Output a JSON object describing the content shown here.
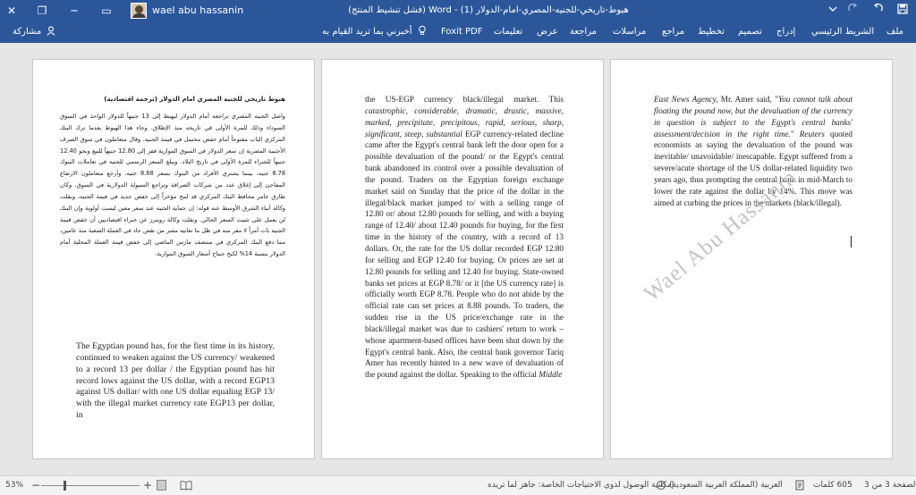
{
  "titlebar": {
    "doc_title": "هبوط-تاريخي-للجنيه-المصري-امام-الدولار (1) - Word (فشل تنشيط المنتج)",
    "user_name": "wael abu hassanin",
    "save_icon": "save-icon",
    "undo_icon": "undo-icon",
    "redo_icon": "redo-icon",
    "customize_icon": "dropdown-icon",
    "close_glyph": "✕",
    "maximize_glyph": "❐",
    "minimize_glyph": "─",
    "ribbon_display_glyph": "▭"
  },
  "ribbon": {
    "tabs": [
      "ملف",
      "الشريط الرئيسي",
      "إدراج",
      "تصميم",
      "تخطيط",
      "مراجع",
      "مراسلات",
      "مراجعة",
      "عرض",
      "تعليمات",
      "Foxit PDF"
    ],
    "tell_me": "أخبرني بما تريد القيام به",
    "share": "مشاركة"
  },
  "pages": {
    "p1_arabic": [
      "هبوط تاريخي للجنيه المصري امام الدولار (ترجمة اقتصادية)",
      "واصل الجنيه المصري تراجعه أمام الدولار ليهبط إلى 13 جنيهاً للدولار الواحد في السوق السوداء وذلك للمرة الأولى في تاريخه منذ الإطلاق. وجاء هذا الهبوط بعدما ترك البنك المركزي الباب مفتوحاً أمام خفض محتمل في قيمة الجنيه. وقال متعاملون في سوق الصرف الأجنبية المصرية إن سعر الدولار في السوق الموازية قفز إلى 12.80 جنيهاً للبيع ونحو 12.40 جنيهاً للشراء للمرة الأولى في تاريخ البلاد. ويبلغ السعر الرسمي للجنيه في تعاملات البنوك 8.78 جنيه، بينما يشتري الأفراد من البنوك بسعر 8.88 جنيه. وأرجع متعاملون الارتفاع المفاجئ إلى إغلاق عدد من شركات الصرافة وتراجع السيولة الدولارية في السوق. وكان طارق عامر محافظ البنك المركزي قد لمح مؤخراً إلى خفض جديد في قيمة الجنيه، ونقلت وكالة أنباء الشرق الأوسط عنه قوله: إن حماية الجنيه عند سعر معين ليست أولوية وإن البنك لن يعمل على تثبيت السعر الحالي. ونقلت وكالة رويترز عن خبراء اقتصاديين أن خفض قيمة الجنيه بات أمراً لا مفر منه في ظل ما تعانيه مصر من نقص حاد في العملة الصعبة منذ عامين، مما دفع البنك المركزي في منتصف مارس الماضي إلى خفض قيمة العملة المحلية أمام الدولار بنسبة 14% لكبح جماح أسعار السوق الموازية."
    ],
    "p1_english": "The Egyptian pound has, for the first time in its history, continued to weaken against the US currency/ weakened to a record 13 per dollar / the Egyptian pound has hit record lows against the US dollar, with a record EGP13 against US dollar/ with one US dollar equaling EGP 13/ with the illegal market currency rate EGP13 per dollar, in",
    "p2_text": [
      {
        "t": "the US-EGP currency black/illegal market. This ",
        "i": false
      },
      {
        "t": "catastrophic, considerable, dramatic, drastic, massive, marked, precipitate, precipitous, rapid, serious, sharp, significant, steep, substantial",
        "i": true
      },
      {
        "t": " EGP currency-related decline came after the Egypt's central bank left the door open for a possible devaluation of the pound/ or the Egypt's central bank abandoned its control over a possible devaluation of the pound. Traders on the Egyptian foreign exchange market said on Sunday that the price of the dollar in the illegal/black market jumped to/ with a selling range of 12.80 or/ about 12.80 pounds for selling, and with a buying range of 12.40/ about 12.40 pounds for buying, for the first time in the history of the country, with a record of 13 dollars. Or, the rate for the US dollar recorded EGP 12.80 for selling and EGP 12.40 for buying. Or prices are set at 12.80 pounds for selling and 12.40 for buying. State-owned banks set prices at EGP 8.78/ or it [the US currency rate] is officially worth EGP 8.78. People who do not abide by the official rate can set prices at 8.88 pounds. To traders, the sudden rise in the US price/exchange rate in the black/illegal market was due to cashiers' return to work – whose apartment-based offices have been shut down by the Egypt's central bank. Also, the central bank governor Tariq Amer has recently hinted to a new wave of devaluation of the pound against the dollar. Speaking to the official ",
        "i": false
      },
      {
        "t": "Middle",
        "i": true
      }
    ],
    "p3_text": [
      {
        "t": "East News Agency,",
        "i": true
      },
      {
        "t": " Mr. Amer said, \"",
        "i": false
      },
      {
        "t": "You cannot talk about floating the pound now, but the devaluation of the currency in question is subject to the Egypt's central banks' assessment/decision in the right time.",
        "i": true
      },
      {
        "t": "\" ",
        "i": false
      },
      {
        "t": "Reuters",
        "i": true
      },
      {
        "t": " quoted economists as saying the devaluation of the pound was inevitable/ unavoidable/ inescapable. Egypt suffered from a severe/acute shortage of the US dollar-related liquidity two years ago, thus prompting the central bank in mid-March to lower the rate against the dollar by 14%. This move was aimed at curbing the prices in the markets (black/illegal).",
        "i": false
      }
    ],
    "watermark": "Wael Abu Hassanin"
  },
  "status": {
    "page": "الصفحة 3 من 3",
    "words": "605 كلمات",
    "language": "العربية (المملكة العربية السعودية)",
    "accessibility": "إمكانية الوصول لذوي الاحتياجات الخاصة: جاهز لما تريده",
    "zoom": "53%",
    "zoom_level": 0.53
  }
}
